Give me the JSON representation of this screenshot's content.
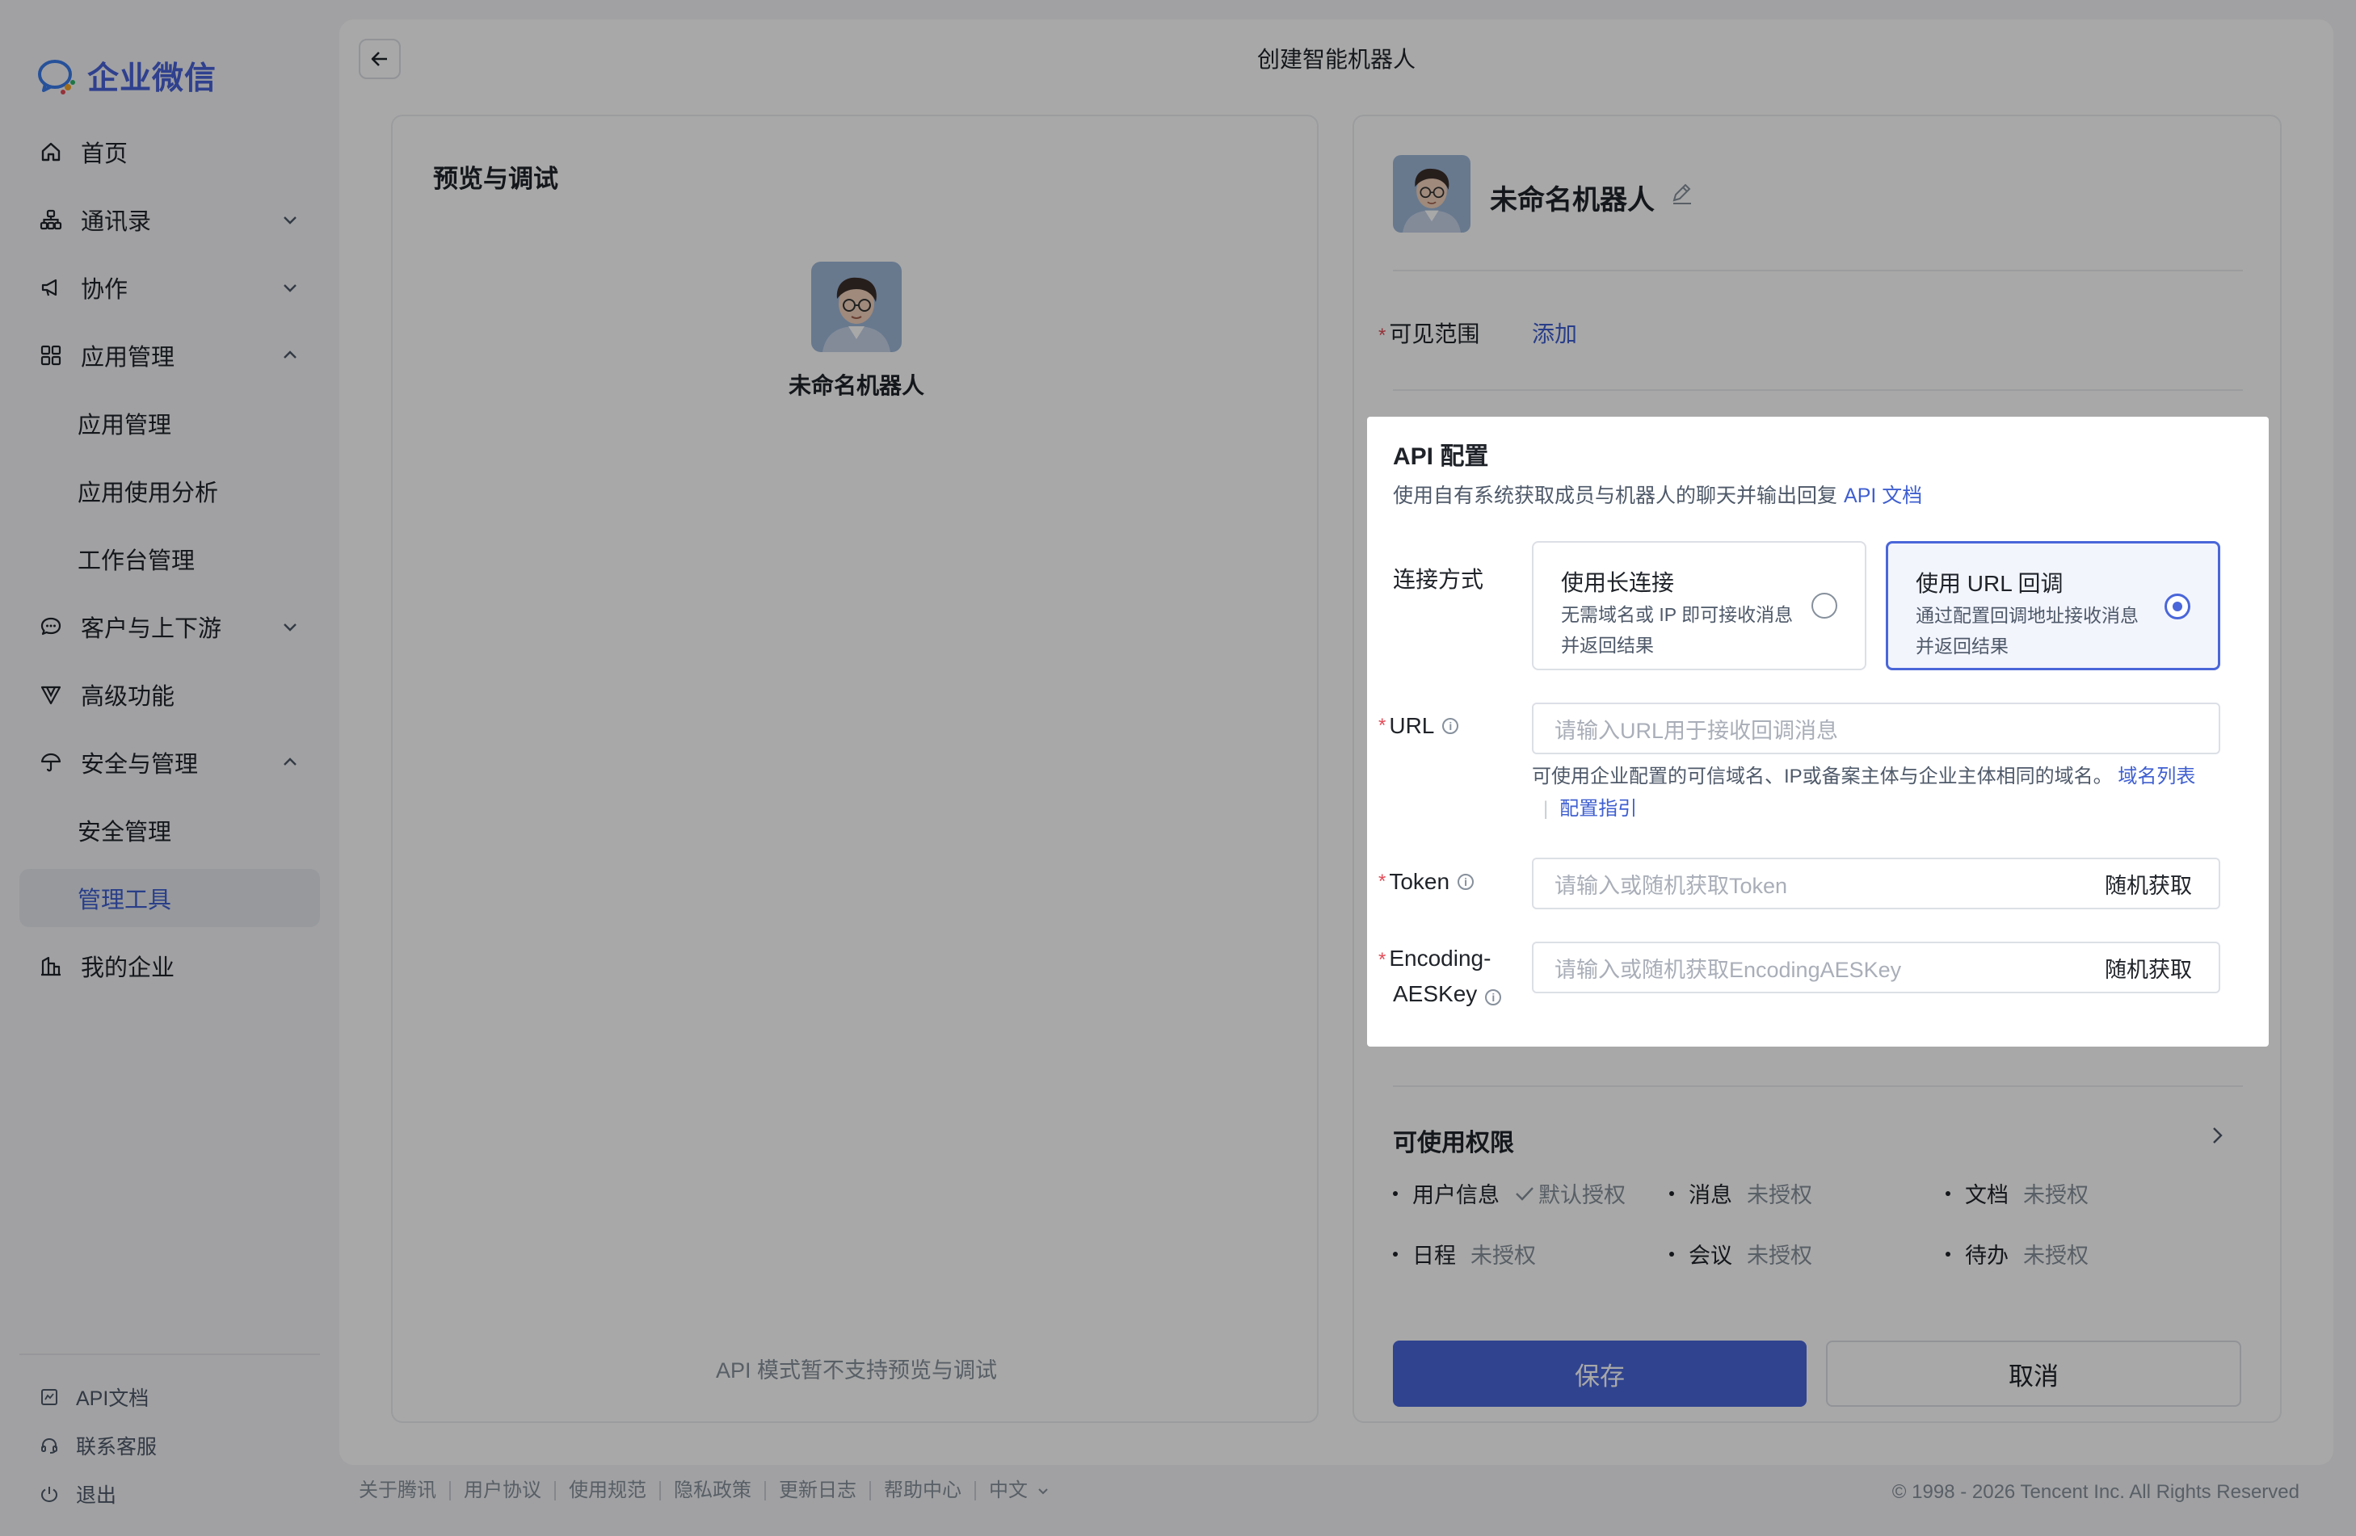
{
  "sidebar": {
    "logo": "企业微信",
    "items": [
      {
        "label": "首页"
      },
      {
        "label": "通讯录"
      },
      {
        "label": "协作"
      },
      {
        "label": "应用管理"
      },
      {
        "label": "应用管理"
      },
      {
        "label": "应用使用分析"
      },
      {
        "label": "工作台管理"
      },
      {
        "label": "客户与上下游"
      },
      {
        "label": "高级功能"
      },
      {
        "label": "安全与管理"
      },
      {
        "label": "安全管理"
      },
      {
        "label": "管理工具"
      },
      {
        "label": "我的企业"
      }
    ],
    "bottom": [
      {
        "label": "API文档"
      },
      {
        "label": "联系客服"
      },
      {
        "label": "退出"
      }
    ]
  },
  "header": {
    "title": "创建智能机器人"
  },
  "preview": {
    "title": "预览与调试",
    "bot_name": "未命名机器人",
    "note": "API 模式暂不支持预览与调试"
  },
  "config": {
    "bot_name": "未命名机器人",
    "scope_label": "可见范围",
    "scope_add": "添加",
    "api": {
      "title": "API 配置",
      "desc": "使用自有系统获取成员与机器人的聊天并输出回复",
      "doc_link": "API 文档",
      "conn_label": "连接方式",
      "options": [
        {
          "title": "使用长连接",
          "desc": "无需域名或 IP 即可接收消息并返回结果",
          "selected": false
        },
        {
          "title": "使用 URL 回调",
          "desc": "通过配置回调地址接收消息并返回结果",
          "selected": true
        }
      ],
      "url_label": "URL",
      "url_placeholder": "请输入URL用于接收回调消息",
      "url_hint": "可使用企业配置的可信域名、IP或备案主体与企业主体相同的域名。",
      "url_hint_link1": "域名列表",
      "url_hint_link2": "配置指引",
      "token_label": "Token",
      "token_placeholder": "请输入或随机获取Token",
      "aes_label_1": "Encoding-",
      "aes_label_2": "AESKey",
      "aes_placeholder": "请输入或随机获取EncodingAESKey",
      "random_btn": "随机获取"
    },
    "perm": {
      "title": "可使用权限",
      "items": [
        {
          "name": "用户信息",
          "status": "默认授权"
        },
        {
          "name": "消息",
          "status": "未授权"
        },
        {
          "name": "文档",
          "status": "未授权"
        },
        {
          "name": "日程",
          "status": "未授权"
        },
        {
          "name": "会议",
          "status": "未授权"
        },
        {
          "name": "待办",
          "status": "未授权"
        }
      ]
    },
    "save": "保存",
    "cancel": "取消"
  },
  "footer": {
    "links": [
      "关于腾讯",
      "用户协议",
      "使用规范",
      "隐私政策",
      "更新日志",
      "帮助中心",
      "中文"
    ],
    "copyright": "© 1998 - 2026 Tencent Inc. All Rights Reserved"
  },
  "colors": {
    "accent": "#4a66d9",
    "link": "#3f5fd0",
    "required": "#e34d59"
  }
}
